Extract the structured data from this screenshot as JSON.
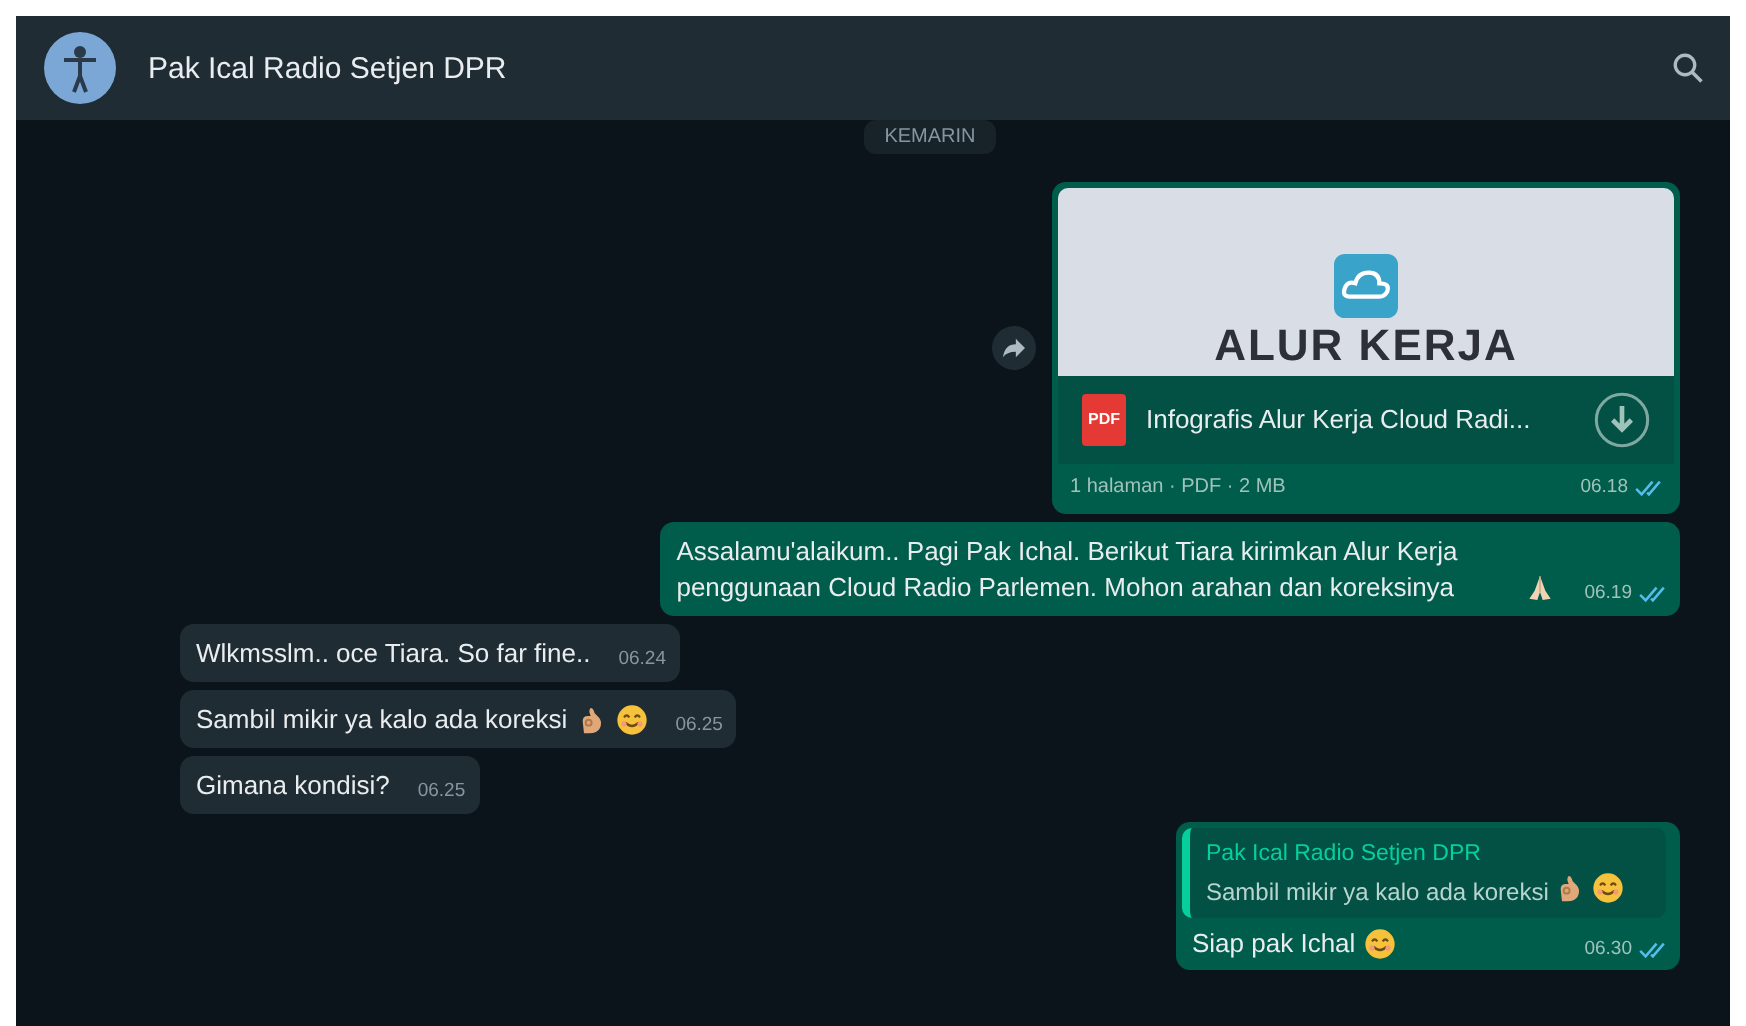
{
  "header": {
    "title": "Pak Ical Radio Setjen DPR"
  },
  "date_chip": "KEMARIN",
  "messages": [
    {
      "kind": "document",
      "outgoing": true,
      "preview_title": "ALUR KERJA",
      "file_name": "Infografis Alur Kerja Cloud Radi...",
      "file_type": "PDF",
      "meta": "1 halaman · PDF · 2 MB",
      "time": "06.18",
      "read": true
    },
    {
      "kind": "text",
      "outgoing": true,
      "text": "Assalamu'alaikum.. Pagi Pak Ichal. Berikut Tiara kirimkan Alur Kerja penggunaan Cloud Radio Parlemen. Mohon arahan dan koreksinya",
      "emoji": [
        {
          "kind": "pray"
        }
      ],
      "time": "06.19",
      "read": true
    },
    {
      "kind": "text",
      "outgoing": false,
      "text": "Wlkmsslm.. oce Tiara. So far fine..",
      "time": "06.24"
    },
    {
      "kind": "text",
      "outgoing": false,
      "text": "Sambil mikir ya kalo ada koreksi",
      "emoji": [
        {
          "kind": "ok"
        },
        {
          "kind": "smile"
        }
      ],
      "time": "06.25"
    },
    {
      "kind": "text",
      "outgoing": false,
      "text": "Gimana kondisi?",
      "time": "06.25"
    },
    {
      "kind": "reply",
      "outgoing": true,
      "quote_author": "Pak Ical Radio Setjen DPR",
      "quote_text": "Sambil mikir ya kalo ada koreksi",
      "quote_emoji": [
        {
          "kind": "ok"
        },
        {
          "kind": "smile"
        }
      ],
      "text": "Siap pak Ichal",
      "emoji": [
        {
          "kind": "smile"
        }
      ],
      "time": "06.30",
      "read": true
    }
  ]
}
